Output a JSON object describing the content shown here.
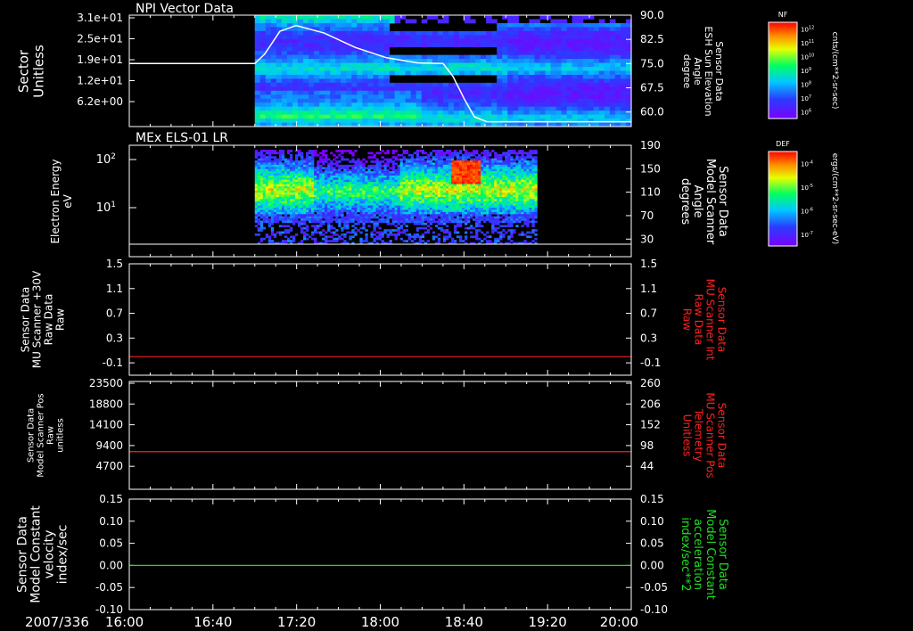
{
  "figure": {
    "start_label": "2007/336",
    "time_ticks": [
      "16:00",
      "16:40",
      "17:20",
      "18:00",
      "18:40",
      "19:20",
      "20:00"
    ],
    "time_range_hours": [
      16.0,
      20.0
    ]
  },
  "colors": {
    "foreground": "#ffffff",
    "trace_red": "#ff2020",
    "trace_green": "#20dd20",
    "background": "#000000"
  },
  "chart_data": [
    {
      "type": "heatmap",
      "title": "NPI Vector Data",
      "ylabel_lines": [
        "Sector",
        "Unitless"
      ],
      "y_ticks": [
        "3.1e+01",
        "2.5e+01",
        "1.9e+01",
        "1.2e+01",
        "6.2e+00"
      ],
      "right_ylabel_lines": [
        "Sensor Data",
        "ESH Sun Elevation",
        "Angle",
        "degree"
      ],
      "right_ticks": [
        "90.0",
        "82.5",
        "75.0",
        "67.5",
        "60.0"
      ],
      "right_ylim": [
        55.5,
        90.0
      ],
      "data_coverage_hours": [
        17.0,
        20.0
      ],
      "colorbar": {
        "label": "NF",
        "unit": "cnts/(cm**2-sr-sec)",
        "ticks": [
          "10^12",
          "10^11",
          "10^10",
          "10^9",
          "10^8",
          "10^7",
          "10^6"
        ]
      },
      "line_series": {
        "name": "ESH Sun Elevation Angle",
        "x_hours": [
          16.0,
          17.0,
          17.08,
          17.2,
          17.33,
          17.55,
          17.8,
          18.05,
          18.3,
          18.5,
          18.58,
          18.67,
          18.75,
          18.85,
          20.0
        ],
        "values": [
          75.0,
          75.0,
          78.0,
          85.0,
          86.8,
          84.5,
          80.0,
          76.8,
          75.2,
          75.0,
          71.0,
          64.0,
          58.5,
          57.0,
          57.0
        ]
      }
    },
    {
      "type": "heatmap",
      "title": "MEx ELS-01 LR",
      "ylabel_lines": [
        "Electron Energy",
        "eV"
      ],
      "y_ticks": [
        "10^2",
        "10^1"
      ],
      "right_ylabel_lines": [
        "Sensor Data",
        "Model Scanner",
        "Angle",
        "degrees"
      ],
      "right_ticks": [
        "190",
        "150",
        "110",
        "70",
        "30"
      ],
      "right_ylim": [
        0,
        190
      ],
      "data_coverage_hours": [
        17.0,
        19.25
      ],
      "colorbar": {
        "label": "DEF",
        "unit": "ergs/(cm**2-sr-sec-eV)",
        "ticks": [
          "10^-4",
          "10^-5",
          "10^-6",
          "10^-7"
        ]
      },
      "line_series": {
        "name": "Model Scanner Angle",
        "value": 0
      }
    },
    {
      "type": "line",
      "ylabel_lines": [
        "Sensor Data",
        "MU Scanner +30V",
        "Raw Data",
        "Raw"
      ],
      "y_ticks": [
        "1.5",
        "1.1",
        "0.7",
        "0.3",
        "-0.1"
      ],
      "ylim": [
        -0.3,
        1.5
      ],
      "right_ylabel_lines": [
        "Sensor Data",
        "MU Scanner Int",
        "Raw Data",
        "Raw"
      ],
      "right_ticks": [
        "1.5",
        "1.1",
        "0.7",
        "0.3",
        "-0.1"
      ],
      "series": [
        {
          "name": "MU Scanner Int",
          "value": 0.0,
          "color": "#ff2020"
        }
      ]
    },
    {
      "type": "line",
      "ylabel_lines": [
        "Sensor Data",
        "Model Scanner Pos",
        "Raw",
        "unitless"
      ],
      "y_ticks": [
        "23500",
        "18800",
        "14100",
        "9400",
        "4700"
      ],
      "ylim": [
        0,
        23500
      ],
      "right_ylabel_lines": [
        "Sensor Data",
        "MU Scanner Pos",
        "Telemetry",
        "Unitless"
      ],
      "right_ticks": [
        "260",
        "206",
        "152",
        "98",
        "44"
      ],
      "series": [
        {
          "name": "MU Scanner Pos",
          "value": 8200,
          "color": "#ff2020"
        }
      ]
    },
    {
      "type": "line",
      "ylabel_lines": [
        "Sensor Data",
        "Model Constant",
        "velocity",
        "index/sec"
      ],
      "y_ticks": [
        "0.15",
        "0.10",
        "0.05",
        "0.00",
        "-0.05",
        "-0.10"
      ],
      "ylim": [
        -0.1,
        0.15
      ],
      "right_ylabel_lines": [
        "Sensor Data",
        "Model Constant",
        "acceleration",
        "index/sec**2"
      ],
      "right_ticks": [
        "0.15",
        "0.10",
        "0.05",
        "0.00",
        "-0.05",
        "-0.10"
      ],
      "series": [
        {
          "name": "Model Constant acceleration",
          "value": 0.0,
          "color": "#20dd20"
        }
      ]
    }
  ]
}
